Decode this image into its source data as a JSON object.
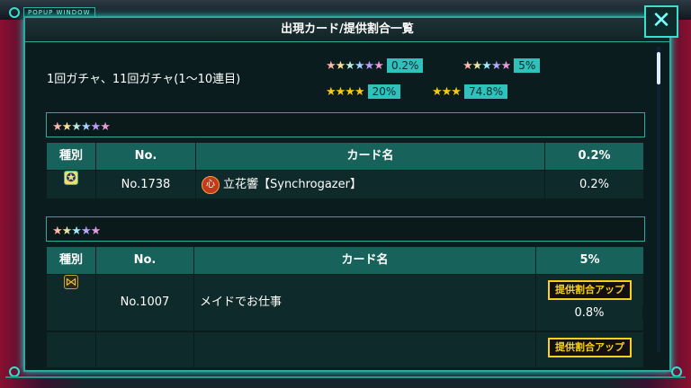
{
  "window": {
    "title": "出現カード/提供割合一覧",
    "tag": "POPUP WINDOW",
    "close_glyph": "✕"
  },
  "gacha": {
    "name": "1回ガチャ、11回ガチャ(1〜10連目)"
  },
  "rates": [
    {
      "stars": "★★★★★★",
      "value": "0.2%"
    },
    {
      "stars": "★★★★★",
      "value": "5%"
    },
    {
      "stars": "★★★★",
      "value": "20%"
    },
    {
      "stars": "★★★",
      "value": "74.8%"
    }
  ],
  "sections": [
    {
      "rarity": "★★★★★★",
      "headers": {
        "type": "種別",
        "no": "No.",
        "name": "カード名",
        "rate": "0.2%"
      },
      "rows": [
        {
          "no": "No.1738",
          "name": "立花響【Synchrogazer】",
          "rate": "0.2%",
          "type_icon": "star-emblem-icon",
          "card_icon": "heart-icon",
          "card_icon_glyph": "心"
        }
      ]
    },
    {
      "rarity": "★★★★★",
      "headers": {
        "type": "種別",
        "no": "No.",
        "name": "カード名",
        "rate": "5%"
      },
      "rows": [
        {
          "no": "No.1007",
          "name": "メイドでお仕事",
          "rate": "0.8%",
          "badge": "提供割合アップ",
          "type_icon": "claw-emblem-icon"
        },
        {
          "no": "",
          "name": "",
          "rate": "",
          "badge": "提供割合アップ"
        }
      ]
    }
  ],
  "colors": {
    "accent": "#2fa9a0",
    "header_bg": "#17625a",
    "row_bg": "#0f2a2a",
    "badge": "#f8d020"
  }
}
